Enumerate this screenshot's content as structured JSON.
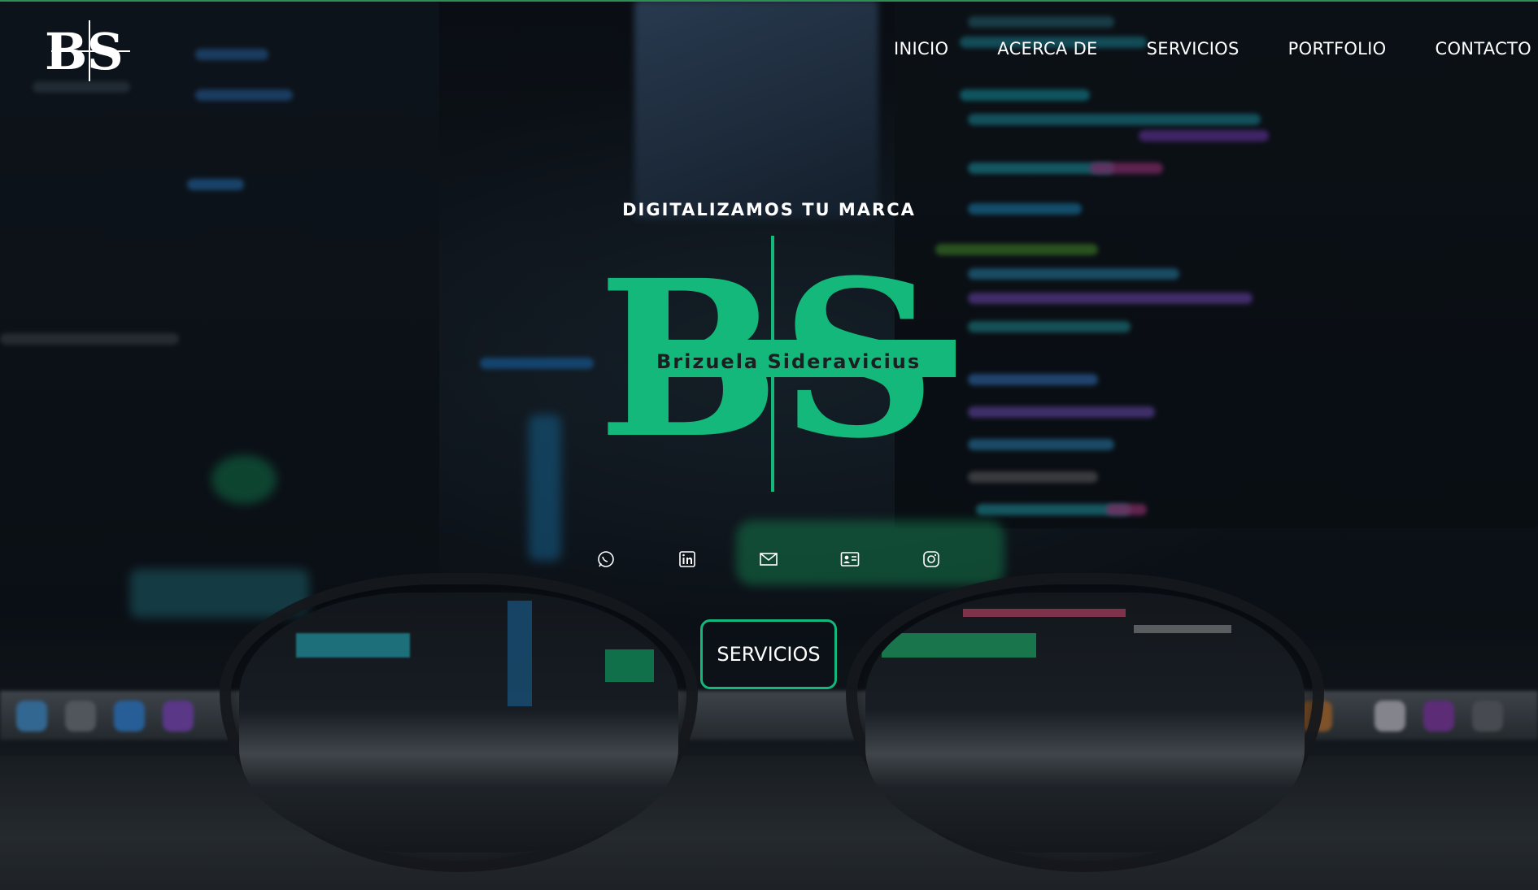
{
  "brand": {
    "small_logo_letters": "B S",
    "logo_letters_b": "B",
    "logo_letters_s": "S",
    "logo_name": "Brizuela Sideravicius",
    "accent_color": "#14b87a"
  },
  "nav": {
    "items": [
      {
        "label": "INICIO"
      },
      {
        "label": "ACERCA DE"
      },
      {
        "label": "SERVICIOS"
      },
      {
        "label": "PORTFOLIO"
      },
      {
        "label": "CONTACTO"
      }
    ]
  },
  "hero": {
    "tagline": "DIGITALIZAMOS TU MARCA",
    "cta_label": "SERVICIOS"
  },
  "social": {
    "icons": [
      "whatsapp-icon",
      "linkedin-icon",
      "email-icon",
      "contact-card-icon",
      "instagram-icon"
    ]
  }
}
